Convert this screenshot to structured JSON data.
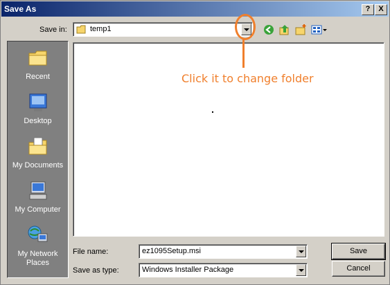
{
  "window": {
    "title": "Save As",
    "help_label": "?",
    "close_label": "X"
  },
  "toolbar": {
    "save_in_label": "Save in:",
    "save_in_value": "temp1",
    "icons": [
      "folder-icon",
      "back-icon",
      "up-folder-icon",
      "new-folder-icon",
      "views-menu-icon"
    ]
  },
  "places": [
    {
      "label": "Recent",
      "icon": "recent-icon"
    },
    {
      "label": "Desktop",
      "icon": "desktop-icon"
    },
    {
      "label": "My Documents",
      "icon": "my-documents-icon"
    },
    {
      "label": "My Computer",
      "icon": "my-computer-icon"
    },
    {
      "label": "My Network Places",
      "icon": "network-places-icon"
    }
  ],
  "annotation": {
    "text": "Click it to change folder",
    "color": "#f07f2c"
  },
  "file_list": {
    "items": []
  },
  "form": {
    "file_name_label": "File name:",
    "file_name_value": "ez1095Setup.msi",
    "save_type_label": "Save as type:",
    "save_type_value": "Windows Installer Package"
  },
  "buttons": {
    "save_label": "Save",
    "cancel_label": "Cancel"
  }
}
